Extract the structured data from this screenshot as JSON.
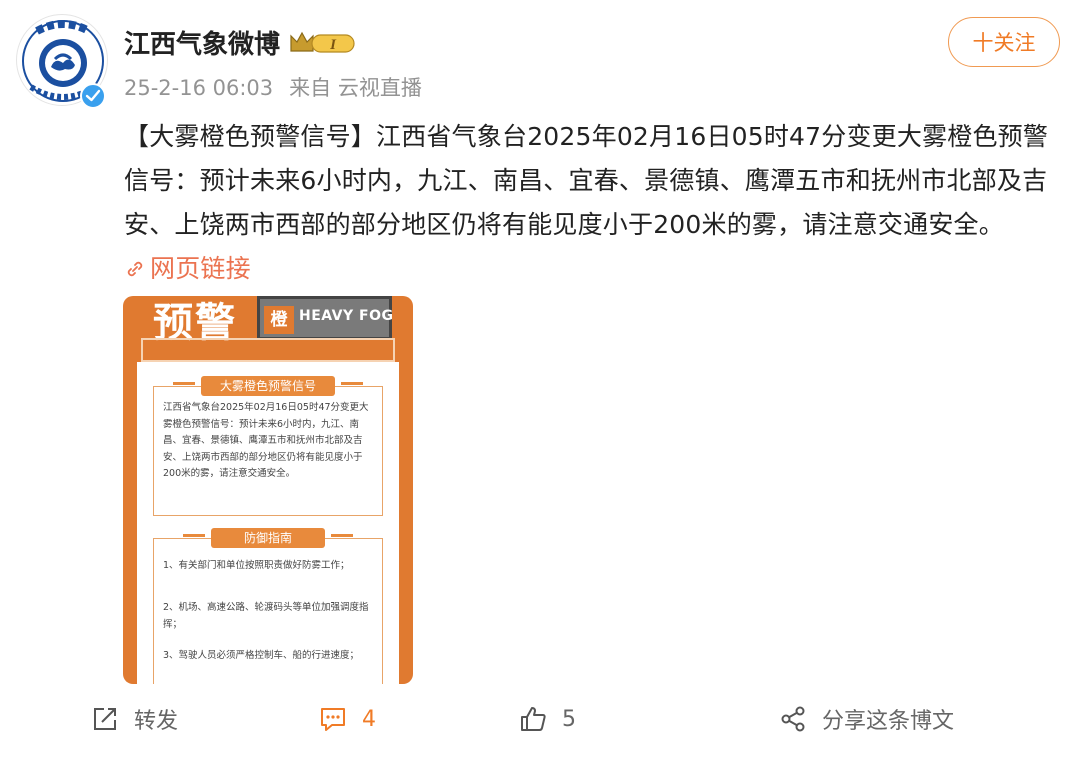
{
  "user": {
    "name": "江西气象微博",
    "badge_text": "I",
    "timestamp": "25-2-16 06:03",
    "source_prefix": "来自",
    "source": "云视直播",
    "avatar_ring_text": "江 西 气 象",
    "avatar_bottom_text": "JIANGXI METEOROLOGY"
  },
  "follow_button": {
    "label": "十关注"
  },
  "post": {
    "text": "【大雾橙色预警信号】江西省气象台2025年02月16日05时47分变更大雾橙色预警信号：预计未来6小时内，九江、南昌、宜春、景德镇、鹰潭五市和抚州市北部及吉安、上饶两市西部的部分地区仍将有能见度小于200米的雾，请注意交通安全。",
    "link_label": "网页链接"
  },
  "poster": {
    "big_title": "预警",
    "tag_char": "橙",
    "tag_text": "HEAVY FOG",
    "section1_title": "大雾橙色预警信号",
    "section1_body": "江西省气象台2025年02月16日05时47分变更大雾橙色预警信号：预计未来6小时内，九江、南昌、宜春、景德镇、鹰潭五市和抚州市北部及吉安、上饶两市西部的部分地区仍将有能见度小于200米的雾，请注意交通安全。",
    "section2_title": "防御指南",
    "guide_1": "1、有关部门和单位按照职责做好防雾工作；",
    "guide_2": "2、机场、高速公路、轮渡码头等单位加强调度指挥；",
    "guide_3": "3、驾驶人员必须严格控制车、船的行进速度；"
  },
  "actions": {
    "repost_label": "转发",
    "comment_count": "4",
    "like_count": "5",
    "share_label": "分享这条博文"
  },
  "colors": {
    "accent": "#f07b26",
    "link": "#eb7350",
    "poster_orange": "#e07a30",
    "verified_blue": "#3aa0ee"
  }
}
